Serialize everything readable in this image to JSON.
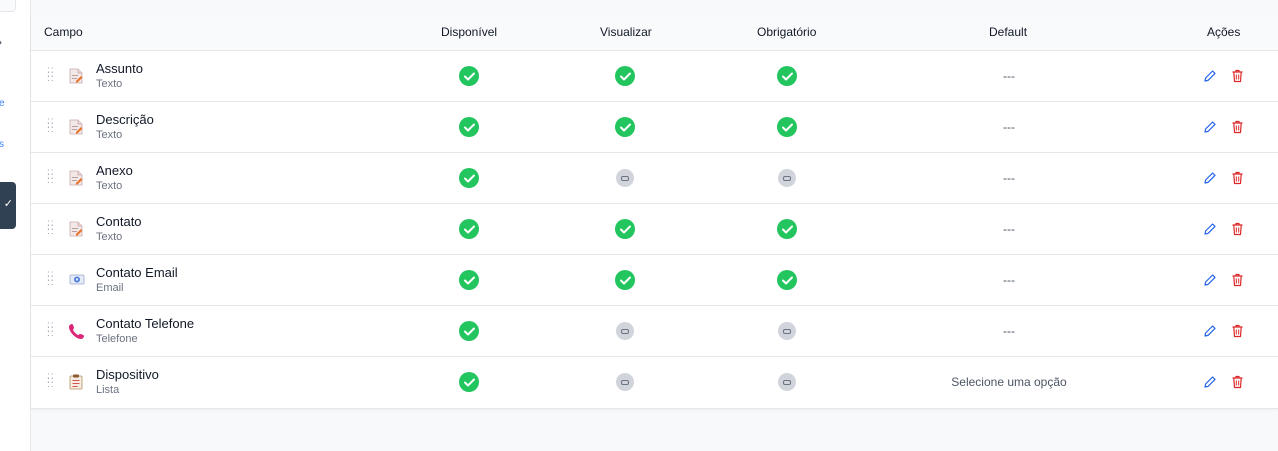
{
  "sidebar": {
    "arrow": "›",
    "item_e": "e",
    "item_s": "s",
    "active_icon": "check-icon"
  },
  "table": {
    "headers": {
      "campo": "Campo",
      "disponivel": "Disponível",
      "visualizar": "Visualizar",
      "obrigatorio": "Obrigatório",
      "default": "Default",
      "acoes": "Ações"
    },
    "rows": [
      {
        "name": "Assunto",
        "type": "Texto",
        "icon": "text-document-icon",
        "disponivel": true,
        "visualizar": true,
        "obrigatorio": true,
        "default": "---"
      },
      {
        "name": "Descrição",
        "type": "Texto",
        "icon": "text-document-icon",
        "disponivel": true,
        "visualizar": true,
        "obrigatorio": true,
        "default": "---"
      },
      {
        "name": "Anexo",
        "type": "Texto",
        "icon": "text-document-icon",
        "disponivel": true,
        "visualizar": false,
        "obrigatorio": false,
        "default": "---"
      },
      {
        "name": "Contato",
        "type": "Texto",
        "icon": "text-document-icon",
        "disponivel": true,
        "visualizar": true,
        "obrigatorio": true,
        "default": "---"
      },
      {
        "name": "Contato Email",
        "type": "Email",
        "icon": "email-icon",
        "disponivel": true,
        "visualizar": true,
        "obrigatorio": true,
        "default": "---"
      },
      {
        "name": "Contato Telefone",
        "type": "Telefone",
        "icon": "phone-icon",
        "disponivel": true,
        "visualizar": false,
        "obrigatorio": false,
        "default": "---"
      },
      {
        "name": "Dispositivo",
        "type": "Lista",
        "icon": "clipboard-list-icon",
        "disponivel": true,
        "visualizar": false,
        "obrigatorio": false,
        "default": "Selecione uma opção"
      }
    ]
  },
  "colors": {
    "enabled": "#22c55e",
    "disabled": "#d1d5db",
    "edit": "#2563eb",
    "delete": "#dc2626",
    "sidebar_active": "#2f4152"
  }
}
